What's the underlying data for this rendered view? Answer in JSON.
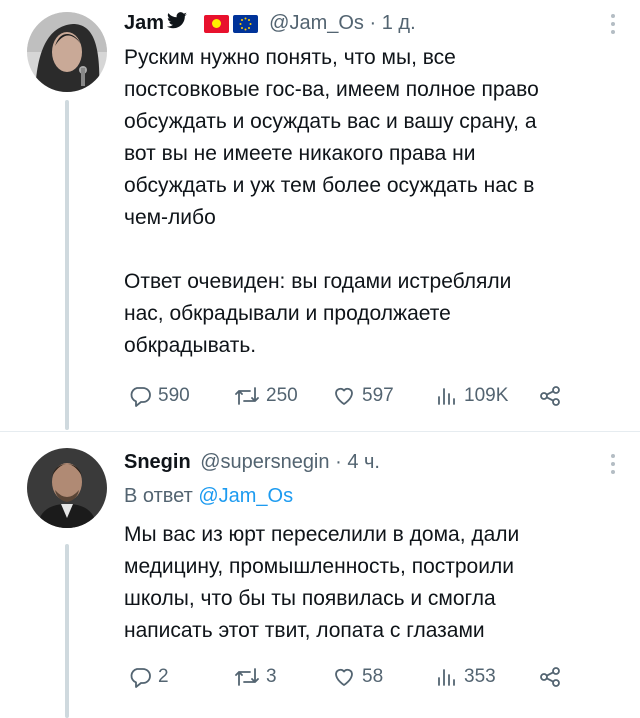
{
  "tweets": [
    {
      "display_name": "Jam",
      "handle": "@Jam_Os",
      "separator": "·",
      "time": "1 д.",
      "reply_prefix": "",
      "reply_handle": "",
      "text_p1": "Руским нужно понять, что мы, все\nпостсовковые гос-ва, имеем полное право\nобсуждать и осуждать вас и вашу срану, а\nвот вы не имеете никакого права ни\nобсуждать и уж тем более осуждать нас в\nчем-либо",
      "text_p2": "Ответ очевиден: вы годами истребляли\nнас, обкрадывали и продолжаете\nобкрадывать.",
      "replies": "590",
      "retweets": "250",
      "likes": "597",
      "views": "109K"
    },
    {
      "display_name": "Snegin",
      "handle": "@supersnegin",
      "separator": "·",
      "time": "4 ч.",
      "reply_prefix": "В ответ",
      "reply_handle": "@Jam_Os",
      "text_p1": "Мы вас из юрт переселили в дома, дали\nмедицину, промышленность, построили\nшколы, что бы ты появилась и смогла\nнаписать этот твит, лопата с глазами",
      "text_p2": "",
      "replies": "2",
      "retweets": "3",
      "likes": "58",
      "views": "353"
    }
  ],
  "icons": [
    "bird-icon",
    "kyrgyz-flag-icon",
    "eu-flag-icon",
    "reply-icon",
    "retweet-icon",
    "like-icon",
    "views-icon",
    "share-icon",
    "more-icon"
  ],
  "colors": {
    "text": "#0f1419",
    "muted": "#536471",
    "link": "#1d9bf0",
    "thread_line": "#cfd9de",
    "kg_flag": "#e8112d",
    "eu_flag": "#003399"
  }
}
